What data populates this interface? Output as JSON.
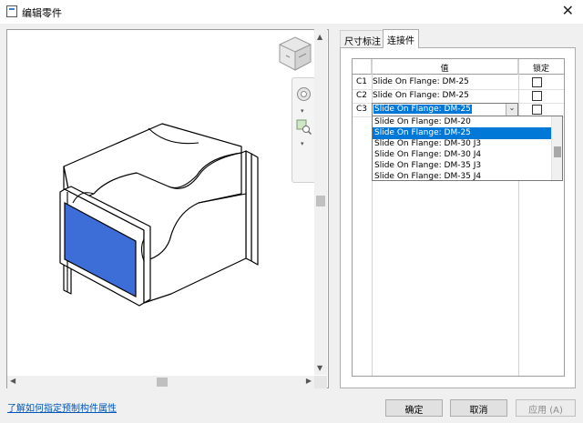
{
  "window": {
    "title": "编辑零件",
    "close_glyph": "✕"
  },
  "tabs": [
    {
      "label": "尺寸标注",
      "active": false
    },
    {
      "label": "连接件",
      "active": true
    }
  ],
  "grid": {
    "headers": {
      "value": "值",
      "lock": "锁定"
    },
    "rows": [
      {
        "id": "C1",
        "value": "Slide On Flange: DM-25",
        "locked": false
      },
      {
        "id": "C2",
        "value": "Slide On Flange: DM-25",
        "locked": false
      },
      {
        "id": "C3",
        "value": "Slide On Flange: DM-25",
        "locked": false,
        "editing": true
      }
    ]
  },
  "combo": {
    "value": "Slide On Flange: DM-25",
    "arrow": "⌄"
  },
  "dropdown": {
    "options": [
      "Slide On Flange: DM-20",
      "Slide On Flange: DM-25",
      "Slide On Flange: DM-30 J3",
      "Slide On Flange: DM-30 J4",
      "Slide On Flange: DM-35 J3",
      "Slide On Flange: DM-35 J4"
    ],
    "selected": "Slide On Flange: DM-25"
  },
  "footer": {
    "help_link": "了解如何指定预制构件属性",
    "ok": "确定",
    "cancel": "取消",
    "apply": "应用 (A)"
  },
  "icons": {
    "viewcube": "viewcube-icon",
    "steering_wheel": "steering-wheel-icon",
    "zoom": "zoom-icon"
  },
  "colors": {
    "accent": "#0078d7",
    "face_fill": "#3d6dd6",
    "link": "#0057b8"
  }
}
